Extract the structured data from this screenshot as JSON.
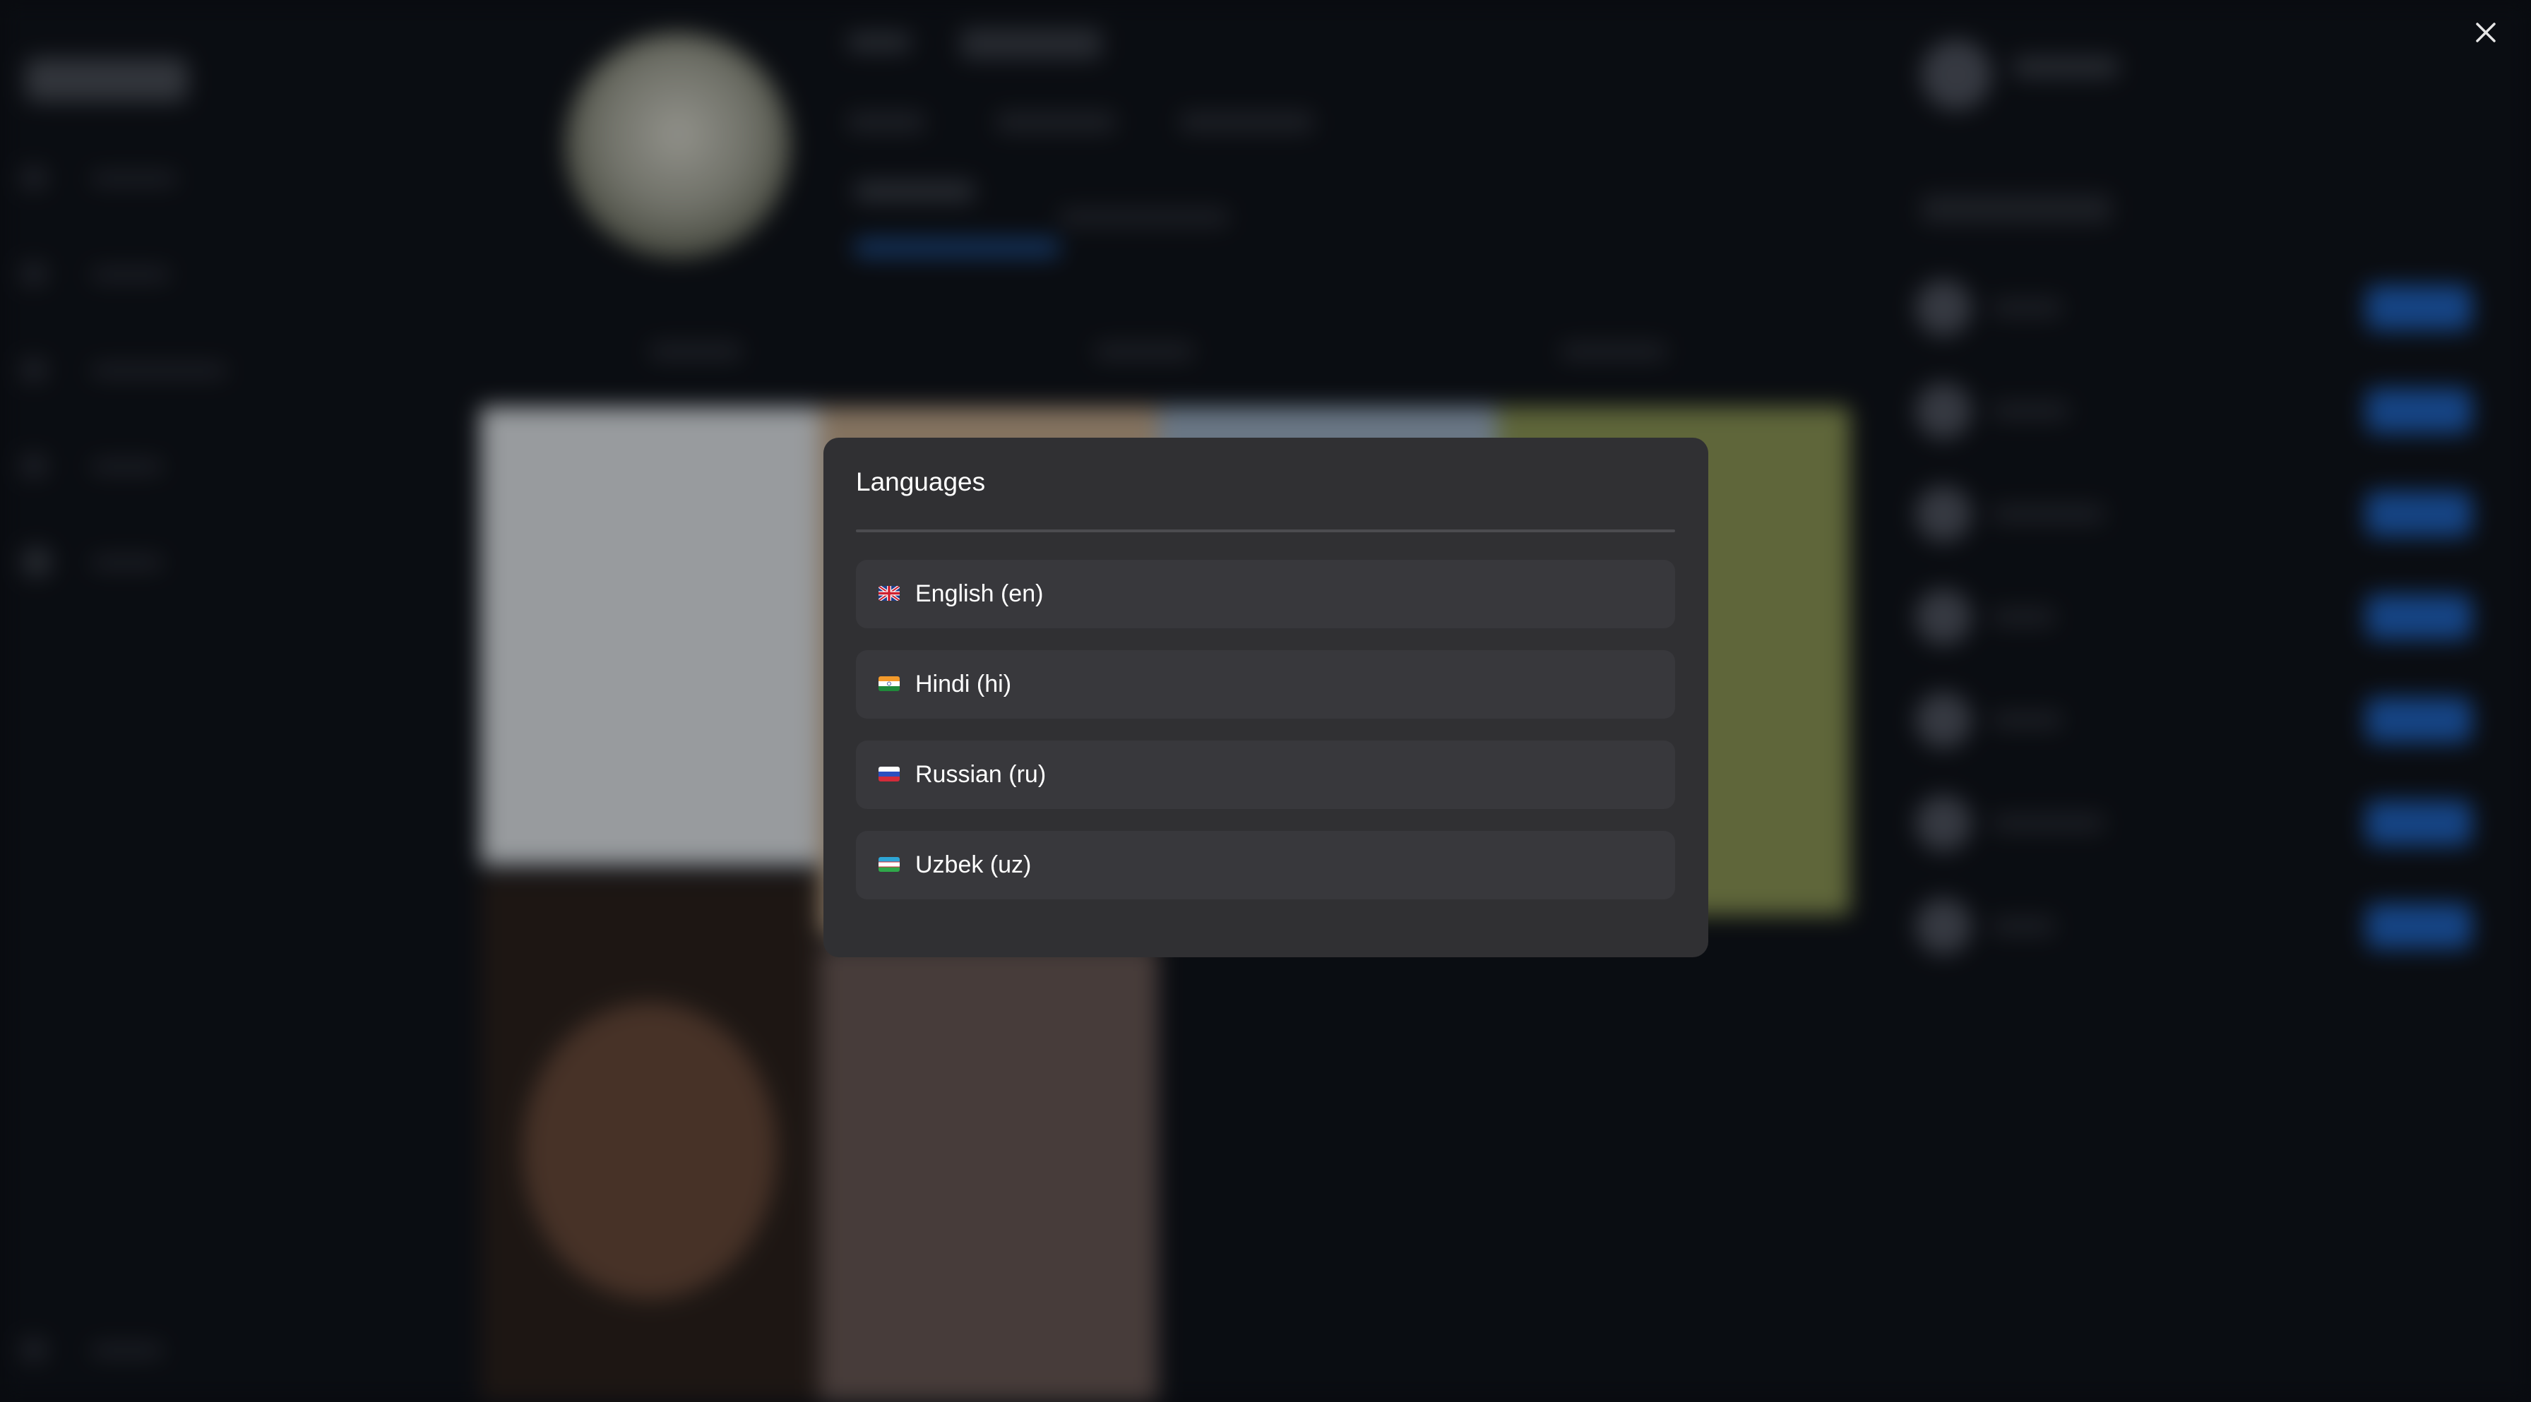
{
  "modal": {
    "title": "Languages",
    "languages": [
      {
        "label": "English (en)",
        "flag": "gb-flag-icon"
      },
      {
        "label": "Hindi (hi)",
        "flag": "in-flag-icon"
      },
      {
        "label": "Russian (ru)",
        "flag": "ru-flag-icon"
      },
      {
        "label": "Uzbek (uz)",
        "flag": "uz-flag-icon"
      }
    ]
  },
  "close": {
    "icon": "close-icon"
  },
  "colors": {
    "modal_bg": "#303033",
    "item_bg": "#38383c",
    "page_bg": "#0b0e13",
    "accent_blue": "#1f66c7"
  }
}
